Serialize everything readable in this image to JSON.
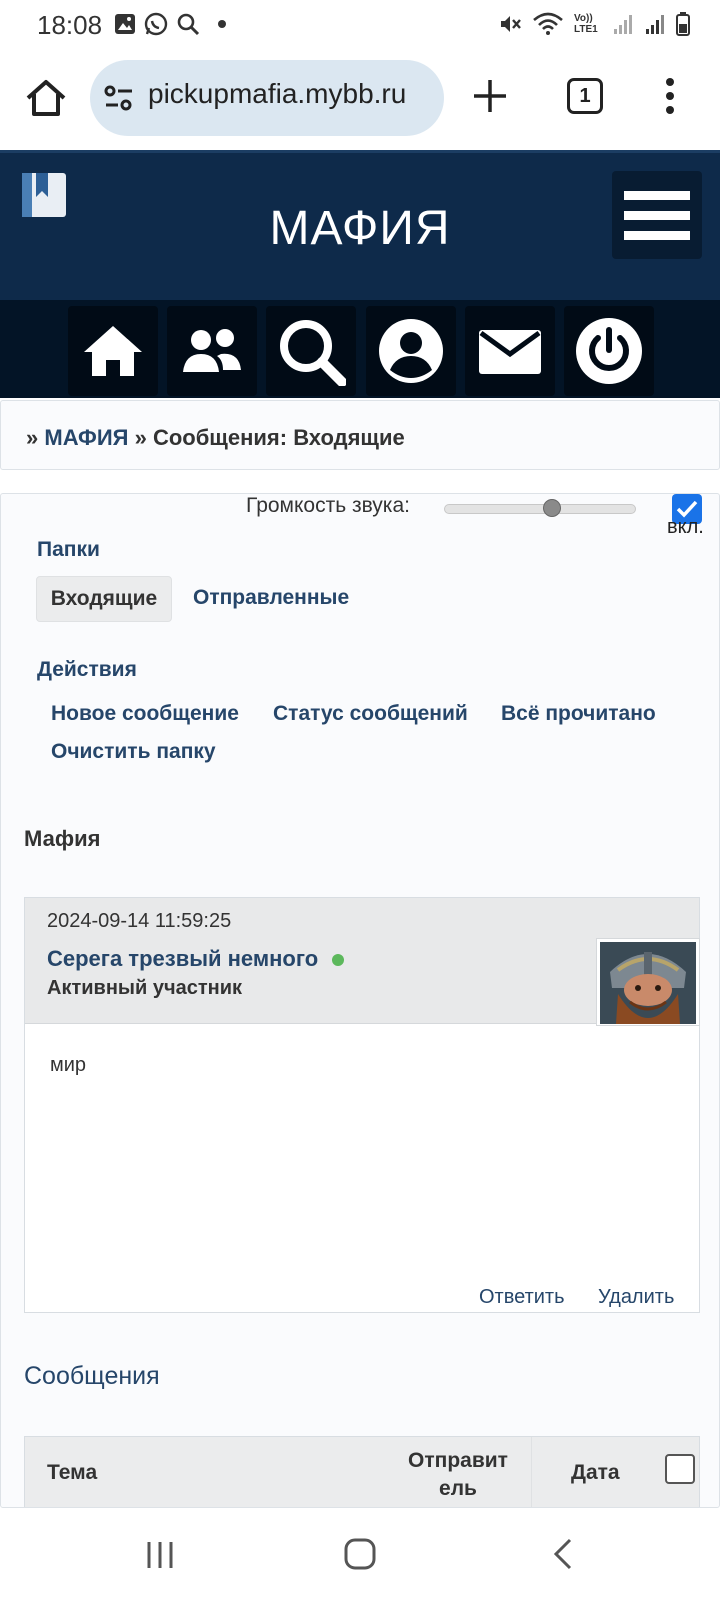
{
  "status_bar": {
    "time": "18:08",
    "volte": "Vo)) LTE1"
  },
  "browser": {
    "url": "pickupmafia.mybb.ru",
    "tab_count": "1"
  },
  "forum": {
    "title": "МАФИЯ",
    "nav": [
      "home-icon",
      "users-icon",
      "search-icon",
      "profile-icon",
      "messages-icon",
      "logout-icon"
    ]
  },
  "breadcrumb": {
    "sep": "»",
    "root": "МАФИЯ",
    "current": "Сообщения: Входящие"
  },
  "volume": {
    "label": "Громкость звука:",
    "level": 0.57,
    "checkbox_label": "вкл.",
    "checked": true
  },
  "folders": {
    "title": "Папки",
    "inbox": "Входящие",
    "sent": "Отправленные"
  },
  "actions": {
    "title": "Действия",
    "new_message": "Новое сообщение",
    "message_status": "Статус сообщений",
    "mark_all_read": "Всё прочитано",
    "clear_folder": "Очистить папку"
  },
  "folder_name": "Мафия",
  "message": {
    "date": "2024-09-14 11:59:25",
    "author": "Серега трезвый немного",
    "role": "Активный участник",
    "body": "мир",
    "reply": "Ответить",
    "delete": "Удалить"
  },
  "messages_section": {
    "title": "Сообщения",
    "col_topic": "Тема",
    "col_sender_1": "Отправит",
    "col_sender_2": "ель",
    "col_date": "Дата"
  },
  "colors": {
    "header_bg": "#0e2a4a",
    "navbar_bg": "#031426",
    "link": "#26466a",
    "online": "#5cb85c"
  }
}
